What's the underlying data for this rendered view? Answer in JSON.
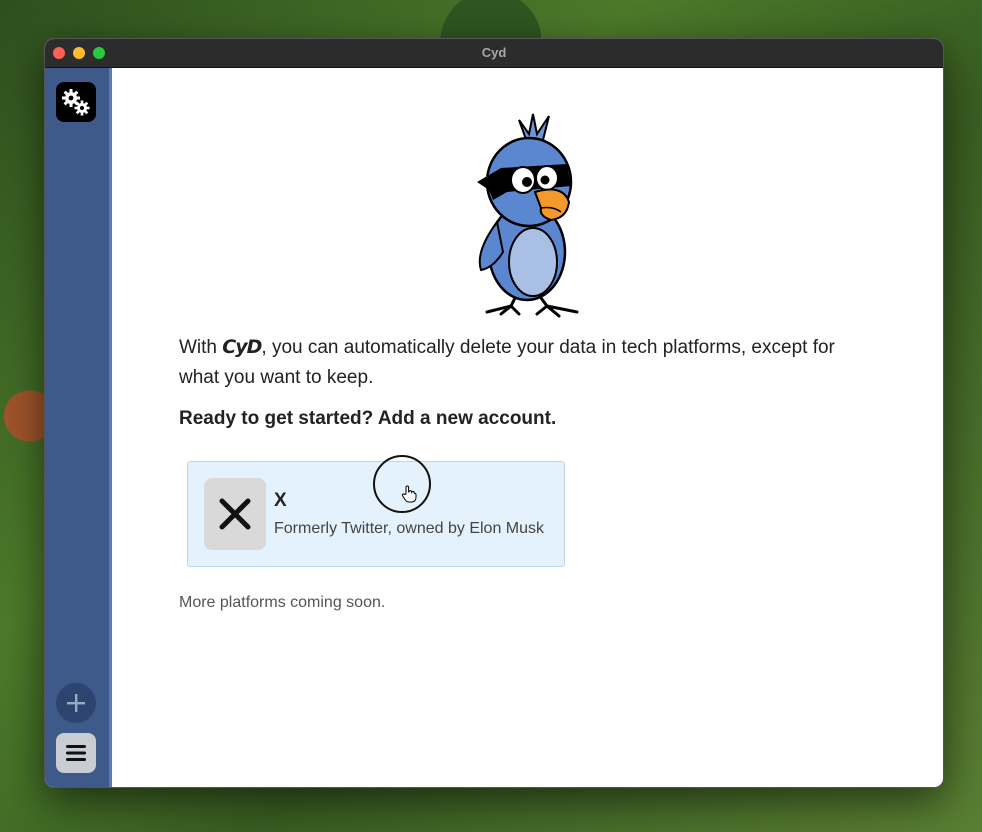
{
  "window": {
    "title": "Cyd"
  },
  "sidebar": {
    "settings_icon": "gears-icon",
    "add_icon": "plus-icon",
    "menu_icon": "hamburger-icon"
  },
  "main": {
    "intro_prefix": "With ",
    "intro_logo": "CyD",
    "intro_suffix": ", you can automatically delete your data in tech platforms, except for what you want to keep.",
    "ready_heading": "Ready to get started? Add a new account.",
    "platforms": [
      {
        "name": "X",
        "description": "Formerly Twitter, owned by Elon Musk",
        "icon": "x-logo-icon"
      }
    ],
    "more_coming": "More platforms coming soon."
  },
  "colors": {
    "sidebar": "#3e5a8a",
    "card_background": "#e3f2fd",
    "titlebar": "#2c2c2c"
  }
}
